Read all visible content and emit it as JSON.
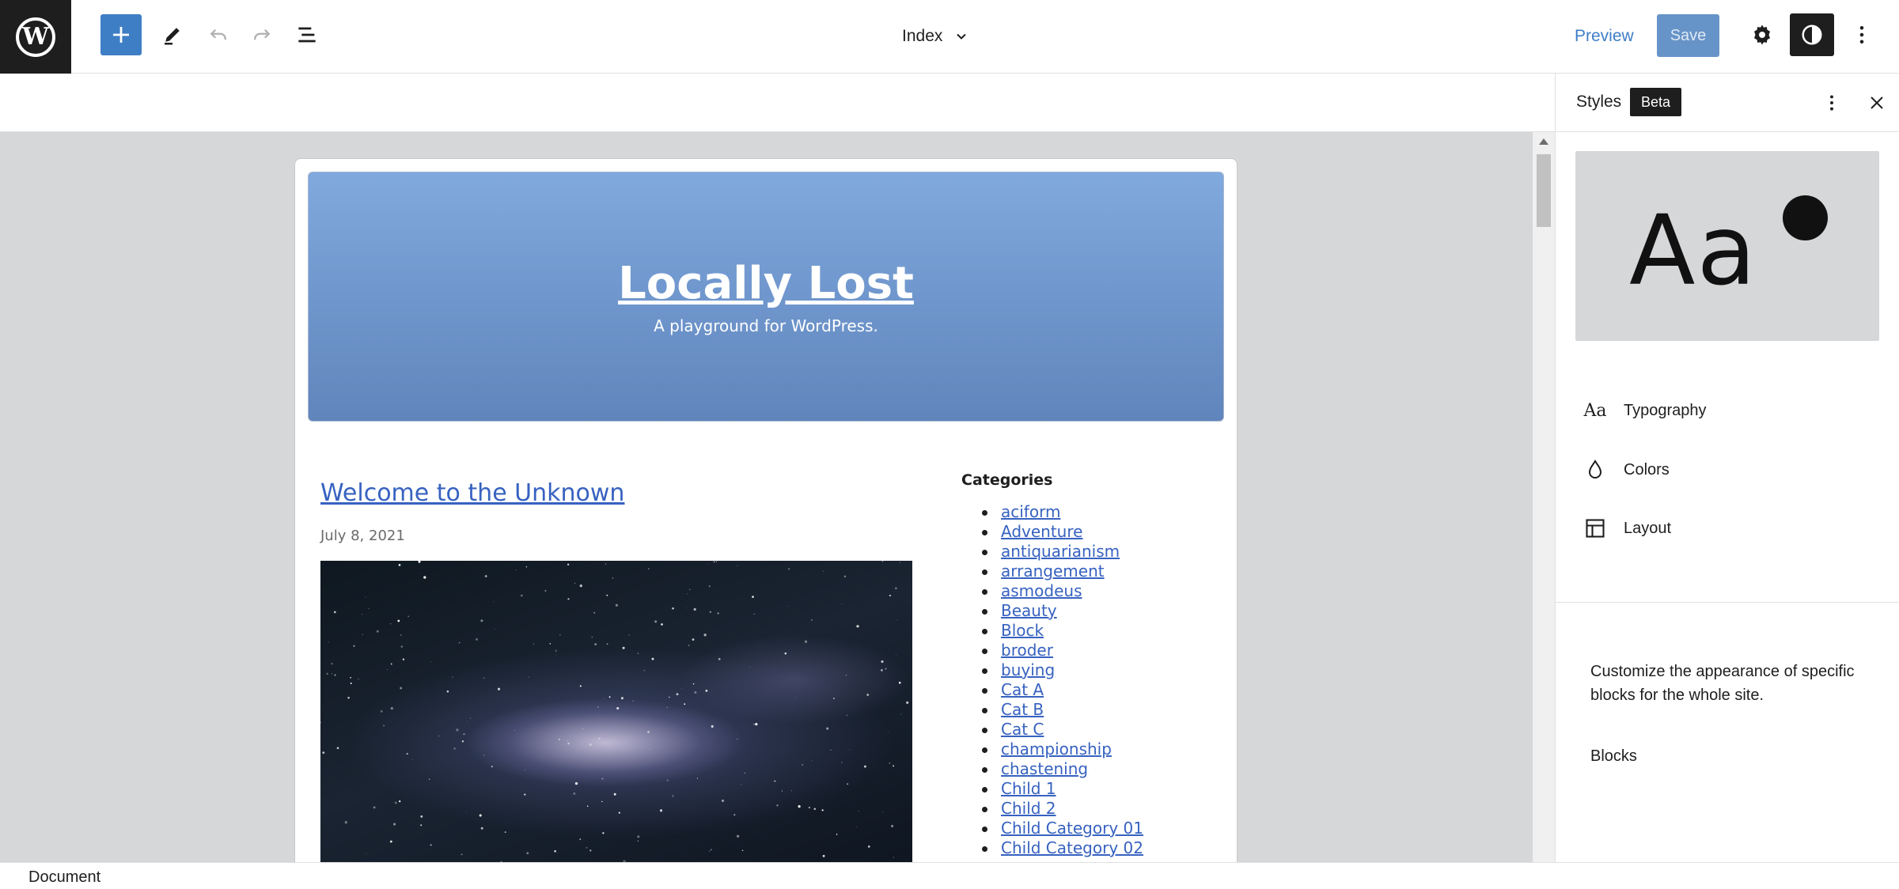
{
  "topbar": {
    "document_title": "Index",
    "preview_label": "Preview",
    "save_label": "Save"
  },
  "canvas": {
    "site_title": "Locally Lost",
    "site_tagline": "A playground for WordPress.",
    "post": {
      "title": "Welcome to the Unknown",
      "date": "July 8, 2021"
    },
    "categories_heading": "Categories",
    "categories": [
      "aciform",
      "Adventure",
      "antiquarianism",
      "arrangement",
      "asmodeus",
      "Beauty",
      "Block",
      "broder",
      "buying",
      "Cat A",
      "Cat B",
      "Cat C",
      "championship",
      "chastening",
      "Child 1",
      "Child 2",
      "Child Category 01",
      "Child Category 02"
    ]
  },
  "sidebar": {
    "title": "Styles",
    "badge": "Beta",
    "preview_text": "Aa",
    "nav": [
      {
        "label": "Typography",
        "icon": "typography-icon"
      },
      {
        "label": "Colors",
        "icon": "droplet-icon"
      },
      {
        "label": "Layout",
        "icon": "layout-icon"
      }
    ],
    "description": "Customize the appearance of specific blocks for the whole site.",
    "blocks_label": "Blocks"
  },
  "footer": {
    "breadcrumb": "Document"
  },
  "colors": {
    "accent": "#3e7ec5",
    "link": "#3762c0",
    "dark": "#1e1e1e"
  }
}
